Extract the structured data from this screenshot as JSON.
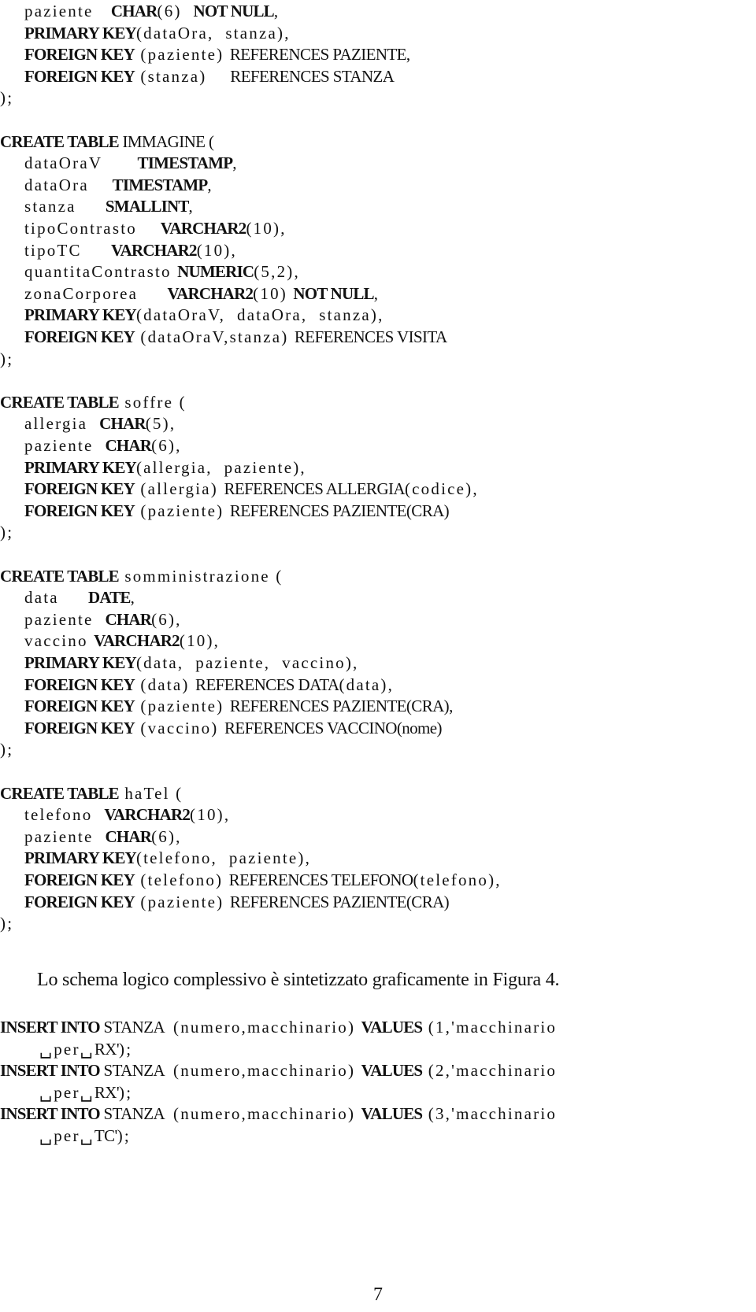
{
  "document": {
    "code_lines": [
      {
        "indent": "indent",
        "segs": [
          [
            "tx",
            "paziente   "
          ],
          [
            "kw",
            "CHAR"
          ],
          [
            "tx",
            "(6)  "
          ],
          [
            "kw",
            "NOT NULL"
          ],
          [
            "tx",
            ","
          ]
        ]
      },
      {
        "indent": "indent",
        "segs": [
          [
            "kw",
            "PRIMARY KEY"
          ],
          [
            "tx",
            "(dataOra,  stanza),"
          ]
        ]
      },
      {
        "indent": "indent",
        "segs": [
          [
            "kw",
            "FOREIGN KEY"
          ],
          [
            "tx",
            " (paziente) "
          ],
          [
            "ref",
            "REFERENCES PAZIENTE,"
          ]
        ]
      },
      {
        "indent": "indent",
        "segs": [
          [
            "kw",
            "FOREIGN KEY"
          ],
          [
            "tx",
            " (stanza)    "
          ],
          [
            "ref",
            "REFERENCES STANZA"
          ]
        ]
      },
      {
        "indent": "none",
        "segs": [
          [
            "tx",
            ");"
          ]
        ]
      },
      {
        "indent": "blank",
        "segs": []
      },
      {
        "indent": "none",
        "segs": [
          [
            "kw",
            "CREATE TABLE"
          ],
          [
            "ref",
            " IMMAGINE "
          ],
          [
            "tx",
            "("
          ]
        ]
      },
      {
        "indent": "indent",
        "segs": [
          [
            "tx",
            "dataOraV      "
          ],
          [
            "kw",
            "TIMESTAMP"
          ],
          [
            "tx",
            ","
          ]
        ]
      },
      {
        "indent": "indent",
        "segs": [
          [
            "tx",
            "dataOra    "
          ],
          [
            "kw",
            "TIMESTAMP"
          ],
          [
            "tx",
            ","
          ]
        ]
      },
      {
        "indent": "indent",
        "segs": [
          [
            "tx",
            "stanza     "
          ],
          [
            "kw",
            "SMALLINT"
          ],
          [
            "tx",
            ","
          ]
        ]
      },
      {
        "indent": "indent",
        "segs": [
          [
            "tx",
            "tipoContrasto    "
          ],
          [
            "kw",
            "VARCHAR2"
          ],
          [
            "tx",
            "(10),"
          ]
        ]
      },
      {
        "indent": "indent",
        "segs": [
          [
            "tx",
            "tipoTC     "
          ],
          [
            "kw",
            "VARCHAR2"
          ],
          [
            "tx",
            "(10),"
          ]
        ]
      },
      {
        "indent": "indent",
        "segs": [
          [
            "tx",
            "quantitaContrasto "
          ],
          [
            "kw",
            "NUMERIC"
          ],
          [
            "tx",
            "(5,2),"
          ]
        ]
      },
      {
        "indent": "indent",
        "segs": [
          [
            "tx",
            "zonaCorporea     "
          ],
          [
            "kw",
            "VARCHAR2"
          ],
          [
            "tx",
            "(10) "
          ],
          [
            "kw",
            "NOT NULL"
          ],
          [
            "tx",
            ","
          ]
        ]
      },
      {
        "indent": "indent",
        "segs": [
          [
            "kw",
            "PRIMARY KEY"
          ],
          [
            "tx",
            "(dataOraV,  dataOra,  stanza),"
          ]
        ]
      },
      {
        "indent": "indent",
        "segs": [
          [
            "kw",
            "FOREIGN KEY"
          ],
          [
            "tx",
            " (dataOraV,stanza) "
          ],
          [
            "ref",
            "REFERENCES VISITA"
          ]
        ]
      },
      {
        "indent": "none",
        "segs": [
          [
            "tx",
            ");"
          ]
        ]
      },
      {
        "indent": "blank",
        "segs": []
      },
      {
        "indent": "none",
        "segs": [
          [
            "kw",
            "CREATE TABLE"
          ],
          [
            "tx",
            " soffre ("
          ]
        ]
      },
      {
        "indent": "indent",
        "segs": [
          [
            "tx",
            "allergia  "
          ],
          [
            "kw",
            "CHAR"
          ],
          [
            "tx",
            "(5),"
          ]
        ]
      },
      {
        "indent": "indent",
        "segs": [
          [
            "tx",
            "paziente  "
          ],
          [
            "kw",
            "CHAR"
          ],
          [
            "tx",
            "(6),"
          ]
        ]
      },
      {
        "indent": "indent",
        "segs": [
          [
            "kw",
            "PRIMARY KEY"
          ],
          [
            "tx",
            "(allergia,  paziente),"
          ]
        ]
      },
      {
        "indent": "indent",
        "segs": [
          [
            "kw",
            "FOREIGN KEY"
          ],
          [
            "tx",
            " (allergia) "
          ],
          [
            "ref",
            "REFERENCES ALLERGIA"
          ],
          [
            "tx",
            "(codice),"
          ]
        ]
      },
      {
        "indent": "indent",
        "segs": [
          [
            "kw",
            "FOREIGN KEY"
          ],
          [
            "tx",
            " (paziente) "
          ],
          [
            "ref",
            "REFERENCES PAZIENTE(CRA)"
          ]
        ]
      },
      {
        "indent": "none",
        "segs": [
          [
            "tx",
            ");"
          ]
        ]
      },
      {
        "indent": "blank",
        "segs": []
      },
      {
        "indent": "none",
        "segs": [
          [
            "kw",
            "CREATE TABLE"
          ],
          [
            "tx",
            " somministrazione ("
          ]
        ]
      },
      {
        "indent": "indent",
        "segs": [
          [
            "tx",
            "data     "
          ],
          [
            "kw",
            "DATE"
          ],
          [
            "tx",
            ","
          ]
        ]
      },
      {
        "indent": "indent",
        "segs": [
          [
            "tx",
            "paziente  "
          ],
          [
            "kw",
            "CHAR"
          ],
          [
            "tx",
            "(6),"
          ]
        ]
      },
      {
        "indent": "indent",
        "segs": [
          [
            "tx",
            "vaccino "
          ],
          [
            "kw",
            "VARCHAR2"
          ],
          [
            "tx",
            "(10),"
          ]
        ]
      },
      {
        "indent": "indent",
        "segs": [
          [
            "kw",
            "PRIMARY KEY"
          ],
          [
            "tx",
            "(data,  paziente,  vaccino),"
          ]
        ]
      },
      {
        "indent": "indent",
        "segs": [
          [
            "kw",
            "FOREIGN KEY"
          ],
          [
            "tx",
            " (data) "
          ],
          [
            "ref",
            "REFERENCES DATA"
          ],
          [
            "tx",
            "(data),"
          ]
        ]
      },
      {
        "indent": "indent",
        "segs": [
          [
            "kw",
            "FOREIGN KEY"
          ],
          [
            "tx",
            " (paziente) "
          ],
          [
            "ref",
            "REFERENCES PAZIENTE(CRA)"
          ],
          [
            "tx",
            ","
          ]
        ]
      },
      {
        "indent": "indent",
        "segs": [
          [
            "kw",
            "FOREIGN KEY"
          ],
          [
            "tx",
            " (vaccino) "
          ],
          [
            "ref",
            "REFERENCES VACCINO(nome)"
          ]
        ]
      },
      {
        "indent": "none",
        "segs": [
          [
            "tx",
            ");"
          ]
        ]
      },
      {
        "indent": "blank",
        "segs": []
      },
      {
        "indent": "none",
        "segs": [
          [
            "kw",
            "CREATE TABLE"
          ],
          [
            "tx",
            " haTel ("
          ]
        ]
      },
      {
        "indent": "indent",
        "segs": [
          [
            "tx",
            "telefono  "
          ],
          [
            "kw",
            "VARCHAR2"
          ],
          [
            "tx",
            "(10),"
          ]
        ]
      },
      {
        "indent": "indent",
        "segs": [
          [
            "tx",
            "paziente  "
          ],
          [
            "kw",
            "CHAR"
          ],
          [
            "tx",
            "(6),"
          ]
        ]
      },
      {
        "indent": "indent",
        "segs": [
          [
            "kw",
            "PRIMARY KEY"
          ],
          [
            "tx",
            "(telefono,  paziente),"
          ]
        ]
      },
      {
        "indent": "indent",
        "segs": [
          [
            "kw",
            "FOREIGN KEY"
          ],
          [
            "tx",
            " (telefono) "
          ],
          [
            "ref",
            "REFERENCES TELEFONO"
          ],
          [
            "tx",
            "(telefono),"
          ]
        ]
      },
      {
        "indent": "indent",
        "segs": [
          [
            "kw",
            "FOREIGN KEY"
          ],
          [
            "tx",
            " (paziente) "
          ],
          [
            "ref",
            "REFERENCES PAZIENTE(CRA)"
          ]
        ]
      },
      {
        "indent": "none",
        "segs": [
          [
            "tx",
            ");"
          ]
        ]
      }
    ],
    "summary_text": "Lo schema logico complessivo è sintetizzato graficamente in Figura 4.",
    "insert_lines": [
      {
        "indent": "none",
        "segs": [
          [
            "kw",
            "INSERT INTO"
          ],
          [
            "ref",
            " STANZA "
          ],
          [
            "tx",
            " (numero,macchinario) "
          ],
          [
            "kw",
            "VALUES"
          ],
          [
            "tx",
            " (1,'macchinario"
          ]
        ]
      },
      {
        "indent": "cont",
        "segs": [
          [
            "tx",
            "␣per␣"
          ],
          [
            "ref",
            "RX'"
          ],
          [
            "tx",
            ");"
          ]
        ]
      },
      {
        "indent": "none",
        "segs": [
          [
            "kw",
            "INSERT INTO"
          ],
          [
            "ref",
            " STANZA "
          ],
          [
            "tx",
            " (numero,macchinario) "
          ],
          [
            "kw",
            "VALUES"
          ],
          [
            "tx",
            " (2,'macchinario"
          ]
        ]
      },
      {
        "indent": "cont",
        "segs": [
          [
            "tx",
            "␣per␣"
          ],
          [
            "ref",
            "RX'"
          ],
          [
            "tx",
            ");"
          ]
        ]
      },
      {
        "indent": "none",
        "segs": [
          [
            "kw",
            "INSERT INTO"
          ],
          [
            "ref",
            " STANZA "
          ],
          [
            "tx",
            " (numero,macchinario) "
          ],
          [
            "kw",
            "VALUES"
          ],
          [
            "tx",
            " (3,'macchinario"
          ]
        ]
      },
      {
        "indent": "cont",
        "segs": [
          [
            "tx",
            "␣per␣"
          ],
          [
            "ref",
            "TC'"
          ],
          [
            "tx",
            ");"
          ]
        ]
      }
    ],
    "page_number": "7"
  }
}
